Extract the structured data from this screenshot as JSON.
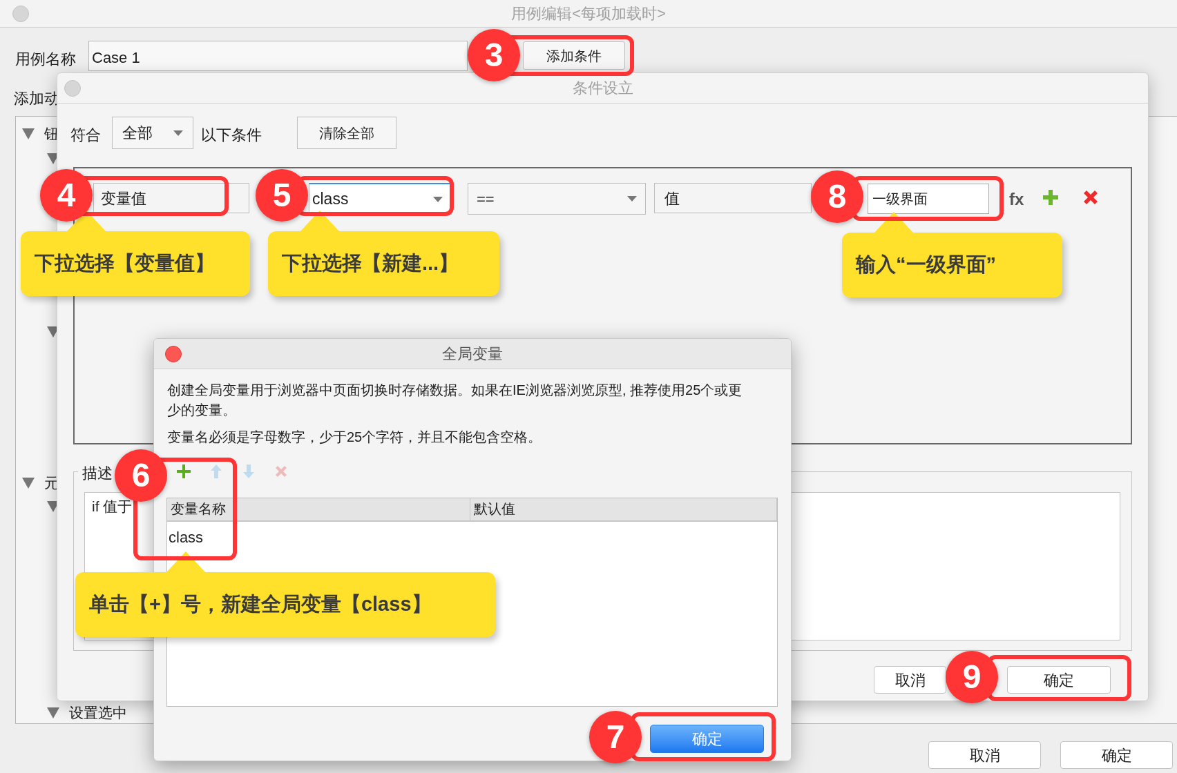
{
  "main_window": {
    "title": "用例编辑<每项加载时>",
    "case_name_label": "用例名称",
    "case_name": "Case 1",
    "add_condition_button": "添加条件",
    "add_action_label": "添加动",
    "tree": [
      {
        "label": "钮",
        "expanded": true,
        "children": [
          {
            "expanded": true
          },
          {
            "expanded": true
          }
        ]
      },
      {
        "label": "元",
        "expanded": true,
        "children": [
          {
            "expanded": true
          },
          {
            "label": "设置选中",
            "expanded": true
          }
        ]
      }
    ],
    "buttons": [
      "取消",
      "确定"
    ]
  },
  "condition_dialog": {
    "title": "条件设立",
    "match_label": "符合",
    "match_value": "全部",
    "match_suffix": "以下条件",
    "clear_button": "清除全部",
    "condition": {
      "type": "变量值",
      "variable": "class",
      "operator": "==",
      "value_type": "值",
      "value": "一级界面",
      "fx_label": "fx"
    },
    "description_label": "描述",
    "description_text": "if 值于",
    "buttons": [
      "取消",
      "确定"
    ]
  },
  "global_variables_dialog": {
    "title": "全局变量",
    "description": [
      "创建全局变量用于浏览器中页面切换时存储数据。如果在IE浏览器浏览原型, 推荐使用25个或更少的变量。",
      "变量名必须是字母数字，少于25个字符，并且不能包含空格。"
    ],
    "toolbar": [
      {
        "kind": "add",
        "disabled": false
      },
      {
        "kind": "up",
        "disabled": true
      },
      {
        "kind": "down",
        "disabled": true
      },
      {
        "kind": "delete",
        "disabled": true
      }
    ],
    "columns": [
      "变量名称",
      "默认值"
    ],
    "rows": [
      {
        "name": "class"
      }
    ],
    "ok_button": "确定"
  },
  "annotations": [
    {
      "number": "3"
    },
    {
      "number": "4"
    },
    {
      "number": "5"
    },
    {
      "number": "8"
    },
    {
      "number": "6"
    },
    {
      "number": "7"
    },
    {
      "number": "9"
    }
  ],
  "callouts": [
    {
      "text": "下拉选择【变量值】"
    },
    {
      "text": "下拉选择【新建...】"
    },
    {
      "text": "输入“一级界面”"
    },
    {
      "text": "单击【+】号，新建全局变量【class】"
    }
  ]
}
